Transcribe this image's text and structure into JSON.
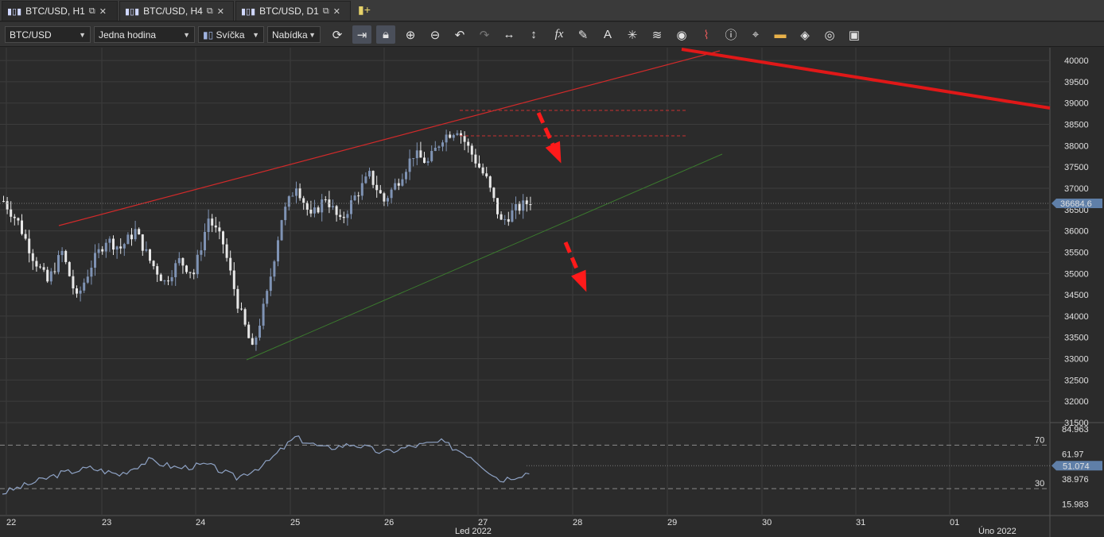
{
  "tabs": [
    {
      "label": "BTC/USD, H1"
    },
    {
      "label": "BTC/USD, H4"
    },
    {
      "label": "BTC/USD, D1"
    }
  ],
  "toolbar": {
    "symbol": "BTC/USD",
    "timeframe": "Jedna hodina",
    "chart_type": "Svíčka",
    "price_side": "Nabídka",
    "icons": [
      "refresh-icon",
      "autoscroll-icon",
      "lock-icon",
      "zoom-in-icon",
      "zoom-out-icon",
      "undo-icon",
      "redo-icon",
      "horizontal-resize-icon",
      "vertical-resize-icon",
      "function-icon",
      "pencil-icon",
      "text-tool-icon",
      "crosshair-icon",
      "layers-icon",
      "eye-icon",
      "alert-icon",
      "info-icon",
      "cursor-icon",
      "color-icon",
      "fill-icon",
      "circle-icon",
      "save-icon"
    ]
  },
  "price_axis": {
    "ticks": [
      "40000",
      "39500",
      "39000",
      "38500",
      "38000",
      "37500",
      "37000",
      "36500",
      "36000",
      "35500",
      "35000",
      "34500",
      "34000",
      "33500",
      "33000",
      "32500",
      "32000",
      "31500"
    ],
    "current_price": "36684.6"
  },
  "rsi_axis": {
    "ticks": [
      "84.963",
      "61.97",
      "38.976",
      "15.983"
    ],
    "levels": [
      "70",
      "30"
    ],
    "current_value": "51.074"
  },
  "time_axis": {
    "ticks": [
      "22",
      "23",
      "24",
      "25",
      "26",
      "27",
      "28",
      "29",
      "30",
      "31",
      "01"
    ],
    "month_labels": [
      "Led 2022",
      "Úno 2022"
    ]
  },
  "colors": {
    "background": "#2b2b2b",
    "grid": "#3c3c3c",
    "candle": "#7f93b4",
    "candle_up": "#e8e8e8",
    "resistance": "#d12a2a",
    "support": "#3b7a2e",
    "arrow": "#ff1a1a",
    "price_tag": "#5f7fa8"
  },
  "chart_data": {
    "type": "candlestick",
    "ylim": [
      31500,
      40300
    ],
    "close_path": [
      [
        0,
        36700
      ],
      [
        4,
        36200
      ],
      [
        8,
        35400
      ],
      [
        12,
        34800
      ],
      [
        16,
        35500
      ],
      [
        20,
        34400
      ],
      [
        24,
        35200
      ],
      [
        28,
        35800
      ],
      [
        32,
        35600
      ],
      [
        36,
        36000
      ],
      [
        40,
        35300
      ],
      [
        44,
        34800
      ],
      [
        48,
        35300
      ],
      [
        52,
        35000
      ],
      [
        56,
        36300
      ],
      [
        60,
        35700
      ],
      [
        64,
        34300
      ],
      [
        68,
        33200
      ],
      [
        72,
        34500
      ],
      [
        76,
        36300
      ],
      [
        80,
        37100
      ],
      [
        84,
        36300
      ],
      [
        88,
        36800
      ],
      [
        92,
        36200
      ],
      [
        96,
        36800
      ],
      [
        100,
        37300
      ],
      [
        104,
        36700
      ],
      [
        108,
        37200
      ],
      [
        112,
        37800
      ],
      [
        116,
        37600
      ],
      [
        120,
        38200
      ],
      [
        124,
        38400
      ],
      [
        128,
        37800
      ],
      [
        132,
        37200
      ],
      [
        136,
        36200
      ],
      [
        140,
        36500
      ],
      [
        144,
        36700
      ]
    ],
    "rsi_path": [
      [
        0,
        26
      ],
      [
        8,
        35
      ],
      [
        16,
        44
      ],
      [
        24,
        49
      ],
      [
        32,
        43
      ],
      [
        40,
        56
      ],
      [
        48,
        49
      ],
      [
        56,
        52
      ],
      [
        64,
        40
      ],
      [
        72,
        53
      ],
      [
        80,
        77
      ],
      [
        88,
        67
      ],
      [
        96,
        71
      ],
      [
        104,
        63
      ],
      [
        112,
        69
      ],
      [
        120,
        73
      ],
      [
        128,
        60
      ],
      [
        136,
        38
      ],
      [
        144,
        45
      ]
    ]
  }
}
